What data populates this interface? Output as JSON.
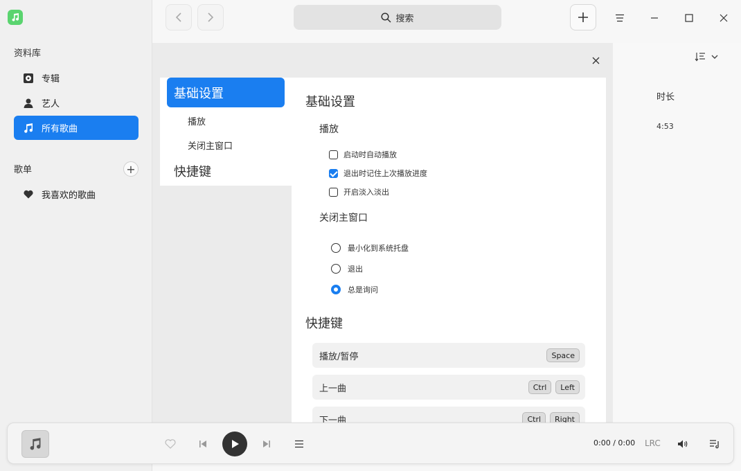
{
  "sidebar": {
    "library_label": "资料库",
    "items": [
      {
        "label": "专辑",
        "icon": "album-icon"
      },
      {
        "label": "艺人",
        "icon": "artist-icon"
      },
      {
        "label": "所有歌曲",
        "icon": "music-note-icon"
      }
    ],
    "playlists_label": "歌单",
    "playlists": [
      {
        "label": "我喜欢的歌曲",
        "icon": "heart-icon"
      }
    ]
  },
  "topbar": {
    "search_label": "搜索"
  },
  "song_list": {
    "duration_header": "时长",
    "rows": [
      {
        "duration": "4:53"
      }
    ]
  },
  "settings": {
    "nav": {
      "basic": "基础设置",
      "playback": "播放",
      "close_window": "关闭主窗口",
      "shortcuts": "快捷键"
    },
    "basic_title": "基础设置",
    "playback_title": "播放",
    "playback_options": [
      {
        "label": "启动时自动播放",
        "checked": false
      },
      {
        "label": "退出时记住上次播放进度",
        "checked": true
      },
      {
        "label": "开启淡入淡出",
        "checked": false
      }
    ],
    "close_title": "关闭主窗口",
    "close_options": [
      {
        "label": "最小化到系统托盘",
        "selected": false
      },
      {
        "label": "退出",
        "selected": false
      },
      {
        "label": "总是询问",
        "selected": true
      }
    ],
    "shortcuts_title": "快捷键",
    "shortcuts": [
      {
        "action": "播放/暂停",
        "keys": [
          "Space"
        ]
      },
      {
        "action": "上一曲",
        "keys": [
          "Ctrl",
          "Left"
        ]
      },
      {
        "action": "下一曲",
        "keys": [
          "Ctrl",
          "Right"
        ]
      }
    ]
  },
  "player": {
    "current_time": "0:00",
    "separator": "/",
    "total_time": "0:00",
    "lrc_label": "LRC"
  },
  "colors": {
    "accent": "#1a7ef0",
    "logo": "#5ad46f"
  }
}
